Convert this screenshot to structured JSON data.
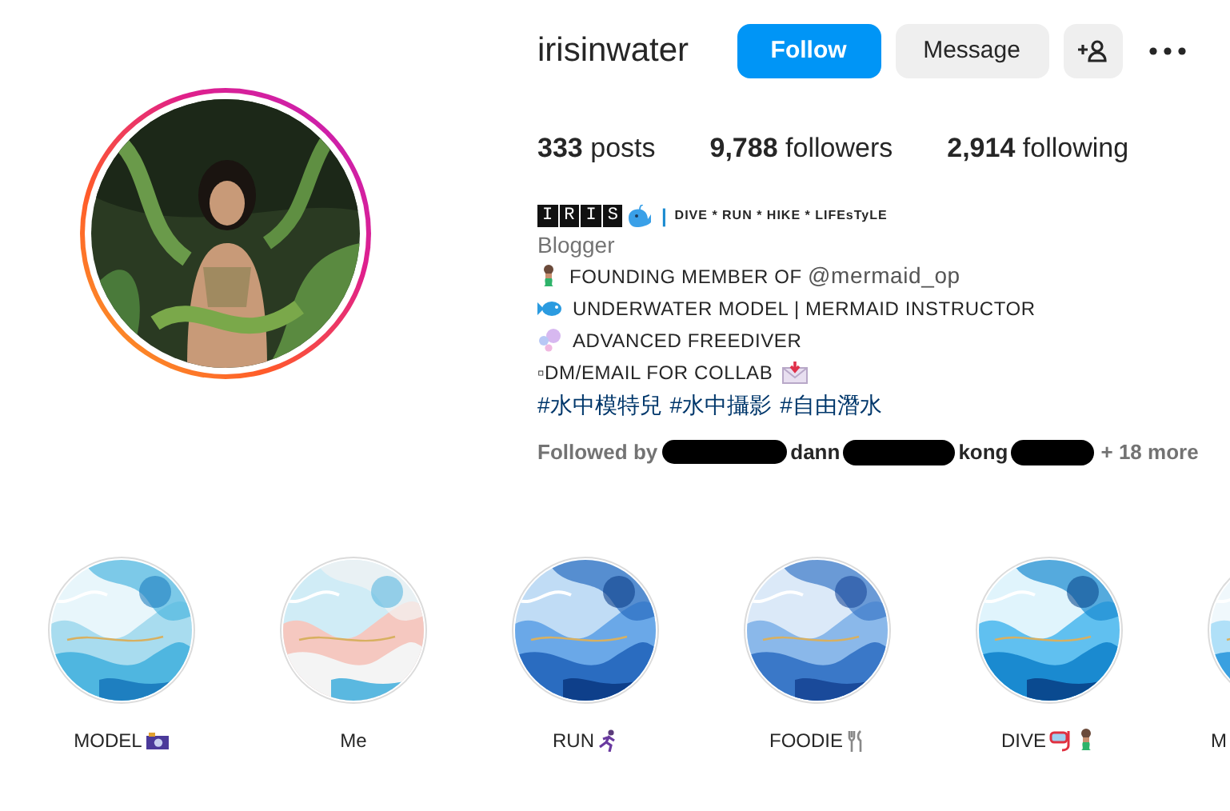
{
  "profile": {
    "username": "irisinwater",
    "buttons": {
      "follow": "Follow",
      "message": "Message"
    },
    "stats": [
      {
        "value": "333",
        "label": "posts"
      },
      {
        "value": "9,788",
        "label": "followers"
      },
      {
        "value": "2,914",
        "label": "following"
      }
    ],
    "bio": {
      "logo_letters": [
        "I",
        "R",
        "I",
        "S"
      ],
      "divider": "|",
      "tagline": "DIVE * RUN * HIKE * LIFEsTyLE",
      "category": "Blogger",
      "lines": [
        {
          "text": "FOUNDING MEMBER OF",
          "mention": "@mermaid_op"
        },
        {
          "text": "UNDERWATER MODEL | MERMAID INSTRUCTOR"
        },
        {
          "text": "ADVANCED FREEDIVER"
        },
        {
          "text": "▫DM/EMAIL FOR COLLAB"
        }
      ],
      "hashtags": [
        "#水中模特兒",
        "#水中攝影",
        "#自由潛水"
      ]
    },
    "followed_by": {
      "label": "Followed by",
      "names": [
        "dann",
        "kong"
      ],
      "more": "+ 18 more"
    }
  },
  "highlights": [
    {
      "label": "MODEL"
    },
    {
      "label": "Me"
    },
    {
      "label": "RUN"
    },
    {
      "label": "FOODIE"
    },
    {
      "label": "DIVE"
    },
    {
      "label": "M"
    }
  ]
}
